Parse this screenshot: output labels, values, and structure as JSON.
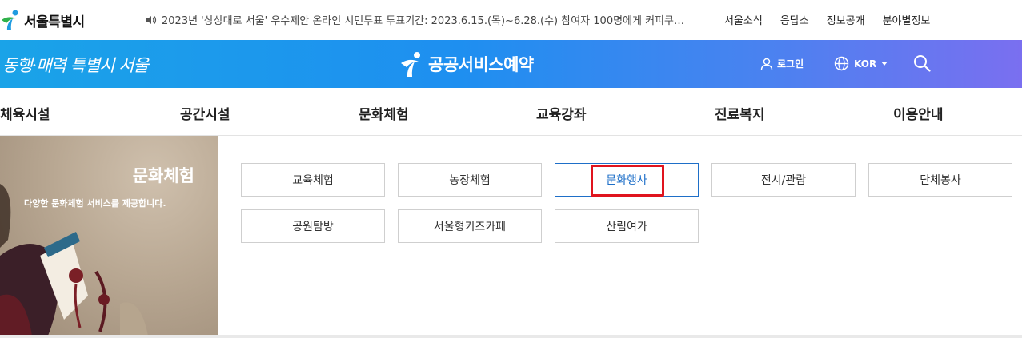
{
  "topbar": {
    "logo_text": "서울특별시",
    "notice_text": "2023년 '상상대로 서울' 우수제안 온라인 시민투표 투표기간: 2023.6.15.(목)~6.28.(수) 참여자 100명에게 커피쿠…",
    "links": [
      "서울소식",
      "응답소",
      "정보공개",
      "분야별정보"
    ]
  },
  "header": {
    "slogan": "동행·매력 특별시 서울",
    "brand": "공공서비스예약",
    "login": "로그인",
    "lang": "KOR"
  },
  "mainnav": {
    "items": [
      "체육시설",
      "공간시설",
      "문화체험",
      "교육강좌",
      "진료복지",
      "이용안내"
    ]
  },
  "banner": {
    "title": "문화체험",
    "description": "다양한 문화체험 서비스를 제공합니다."
  },
  "submenu": {
    "items": [
      "교육체험",
      "농장체험",
      "문화행사",
      "전시/관람",
      "단체봉사",
      "공원탐방",
      "서울형키즈카페",
      "산림여가"
    ],
    "active": "문화행사"
  },
  "colors": {
    "header_gradient_start": "#1aa3e8",
    "header_gradient_end": "#7a6ff0",
    "active_blue": "#1e6fc8",
    "highlight_red": "#e0141e"
  },
  "icons": [
    "seoul-logo-icon",
    "speaker-icon",
    "brand-logo-icon",
    "user-icon",
    "globe-icon",
    "caret-down-icon",
    "search-icon"
  ]
}
